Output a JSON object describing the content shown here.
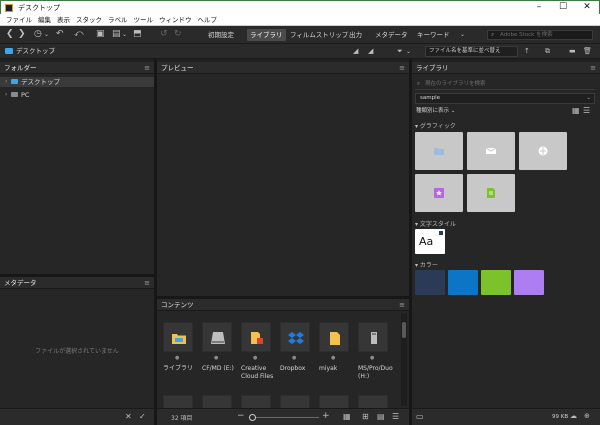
{
  "window": {
    "title": "デスクトップ"
  },
  "menu": [
    "ファイル",
    "編集",
    "表示",
    "スタック",
    "ラベル",
    "ツール",
    "ウィンドウ",
    "ヘルプ"
  ],
  "workspaces": [
    "初期設定",
    "ライブラリ",
    "フィルムストリップ",
    "出力",
    "メタデータ",
    "キーワード"
  ],
  "active_workspace": "ライブラリ",
  "search_placeholder": "Adobe Stock を検索",
  "breadcrumb": "デスクトップ",
  "sort_label": "ファイル名を基準に並べ替え",
  "panels": {
    "folders": "フォルダー",
    "preview": "プレビュー",
    "libraries": "ライブラリ",
    "metadata": "メタデータ",
    "content": "コンテンツ"
  },
  "folder_tree": [
    {
      "label": "デスクトップ",
      "icon": "folder-icon",
      "selected": true
    },
    {
      "label": "PC",
      "icon": "pc-icon",
      "selected": false
    }
  ],
  "metadata_empty": "ファイルが選択されていません",
  "content_items": [
    {
      "label": "ライブラリ",
      "icon": "library-folder-icon"
    },
    {
      "label": "CF/MD (E:)",
      "icon": "drive-icon"
    },
    {
      "label": "Creative Cloud Files",
      "icon": "cc-folder-icon"
    },
    {
      "label": "Dropbox",
      "icon": "dropbox-icon"
    },
    {
      "label": "miyak",
      "icon": "user-folder-icon"
    },
    {
      "label": "MS/Pro/Duo (H:)",
      "icon": "usb-drive-icon"
    }
  ],
  "content_status": "32 項目",
  "library": {
    "search_placeholder": "現在のライブラリを検索",
    "selected": "sample",
    "view_label": "種類別に表示",
    "graphics_title": "グラフィック",
    "char_styles_title": "文字スタイル",
    "char_style_sample": "Aa",
    "colors_title": "カラー",
    "colors": [
      "#2b3a57",
      "#0b75c7",
      "#7cc22a",
      "#ac7ef2"
    ],
    "size_status": "99 KB"
  }
}
